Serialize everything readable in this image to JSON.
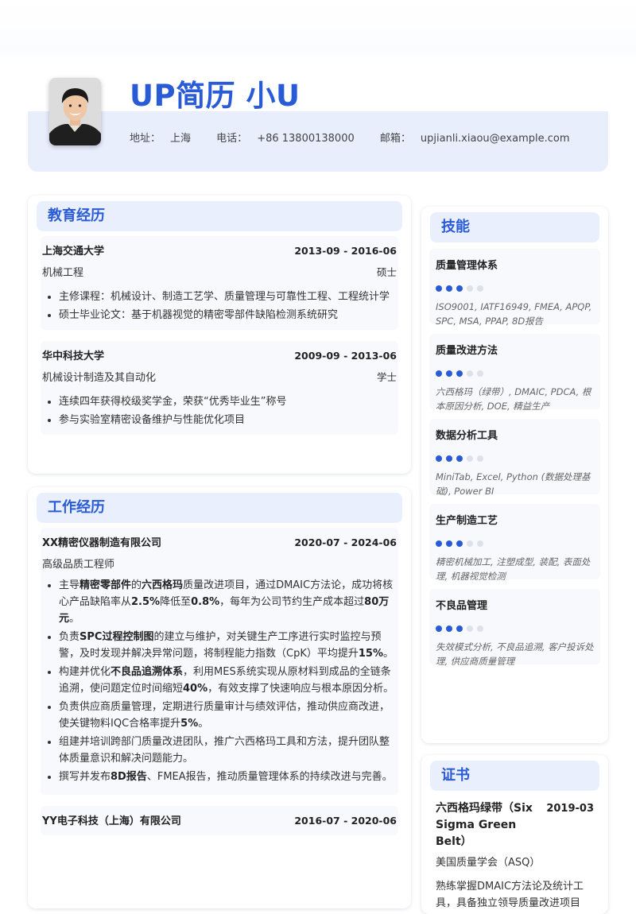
{
  "header": {
    "name": "UP简历 小U",
    "contact": [
      {
        "label": "地址：",
        "value": "上海"
      },
      {
        "label": "电话：",
        "value": "+86 13800138000"
      },
      {
        "label": "邮箱：",
        "value": "upjianli.xiaou@example.com"
      }
    ]
  },
  "education": {
    "title": "教育经历",
    "entries": [
      {
        "school": "上海交通大学",
        "date": "2013-09 - 2016-06",
        "major": "机械工程",
        "degree": "硕士",
        "bullets": [
          "主修课程：机械设计、制造工艺学、质量管理与可靠性工程、工程统计学",
          "硕士毕业论文：基于机器视觉的精密零部件缺陷检测系统研究"
        ]
      },
      {
        "school": "华中科技大学",
        "date": "2009-09 - 2013-06",
        "major": "机械设计制造及其自动化",
        "degree": "学士",
        "bullets": [
          "连续四年获得校级奖学金，荣获“优秀毕业生”称号",
          "参与实验室精密设备维护与性能优化项目"
        ]
      }
    ]
  },
  "work": {
    "title": "工作经历",
    "entries": [
      {
        "company": "XX精密仪器制造有限公司",
        "date": "2020-07 - 2024-06",
        "role": "高级品质工程师",
        "bullets": [
          [
            {
              "t": "主导"
            },
            {
              "t": "精密零部件",
              "b": true
            },
            {
              "t": "的"
            },
            {
              "t": "六西格玛",
              "b": true
            },
            {
              "t": "质量改进项目，通过DMAIC方法论，成功将核心产品缺陷率从"
            },
            {
              "t": "2.5%",
              "b": true
            },
            {
              "t": "降低至"
            },
            {
              "t": "0.8%",
              "b": true
            },
            {
              "t": "，每年为公司节约生产成本超过"
            },
            {
              "t": "80万元",
              "b": true
            },
            {
              "t": "。"
            }
          ],
          [
            {
              "t": "负责"
            },
            {
              "t": "SPC过程控制图",
              "b": true
            },
            {
              "t": "的建立与维护，对关键生产工序进行实时监控与预警，及时发现并解决异常问题，将制程能力指数（CpK）平均提升"
            },
            {
              "t": "15%",
              "b": true
            },
            {
              "t": "。"
            }
          ],
          [
            {
              "t": "构建并优化"
            },
            {
              "t": "不良品追溯体系",
              "b": true
            },
            {
              "t": "，利用MES系统实现从原材料到成品的全链条追溯，使问题定位时间缩短"
            },
            {
              "t": "40%",
              "b": true
            },
            {
              "t": "，有效支撑了快速响应与根本原因分析。"
            }
          ],
          [
            {
              "t": "负责供应商质量管理，定期进行质量审计与绩效评估，推动供应商改进，使关键物料IQC合格率提升"
            },
            {
              "t": "5%",
              "b": true
            },
            {
              "t": "。"
            }
          ],
          [
            {
              "t": "组建并培训跨部门质量改进团队，推广六西格玛工具和方法，提升团队整体质量意识和解决问题能力。"
            }
          ],
          [
            {
              "t": "撰写并发布"
            },
            {
              "t": "8D报告",
              "b": true
            },
            {
              "t": "、FMEA报告，推动质量管理体系的持续改进与完善。"
            }
          ]
        ]
      },
      {
        "company": "YY电子科技（上海）有限公司",
        "date": "2016-07 - 2020-06"
      }
    ]
  },
  "skills": {
    "title": "技能",
    "items": [
      {
        "name": "质量管理体系",
        "level": 3,
        "max": 5,
        "desc": "ISO9001, IATF16949, FMEA, APQP, SPC, MSA, PPAP, 8D报告"
      },
      {
        "name": "质量改进方法",
        "level": 3,
        "max": 5,
        "desc": "六西格玛（绿带）, DMAIC, PDCA, 根本原因分析, DOE, 精益生产"
      },
      {
        "name": "数据分析工具",
        "level": 3,
        "max": 5,
        "desc": "MiniTab, Excel, Python (数据处理基础), Power BI"
      },
      {
        "name": "生产制造工艺",
        "level": 3,
        "max": 5,
        "desc": "精密机械加工, 注塑成型, 装配, 表面处理, 机器视觉检测"
      },
      {
        "name": "不良品管理",
        "level": 3,
        "max": 5,
        "desc": "失效模式分析, 不良品追溯, 客户投诉处理, 供应商质量管理"
      }
    ]
  },
  "certificates": {
    "title": "证书",
    "items": [
      {
        "name": "六西格玛绿带（Six Sigma Green Belt）",
        "date": "2019-03",
        "issuer": "美国质量学会（ASQ）",
        "desc": "熟练掌握DMAIC方法论及统计工具，具备独立领导质量改进项目"
      }
    ]
  },
  "colors": {
    "accent": "#2a5bd7",
    "band": "#e9eefd",
    "entry_bg": "#f8f9fd"
  }
}
